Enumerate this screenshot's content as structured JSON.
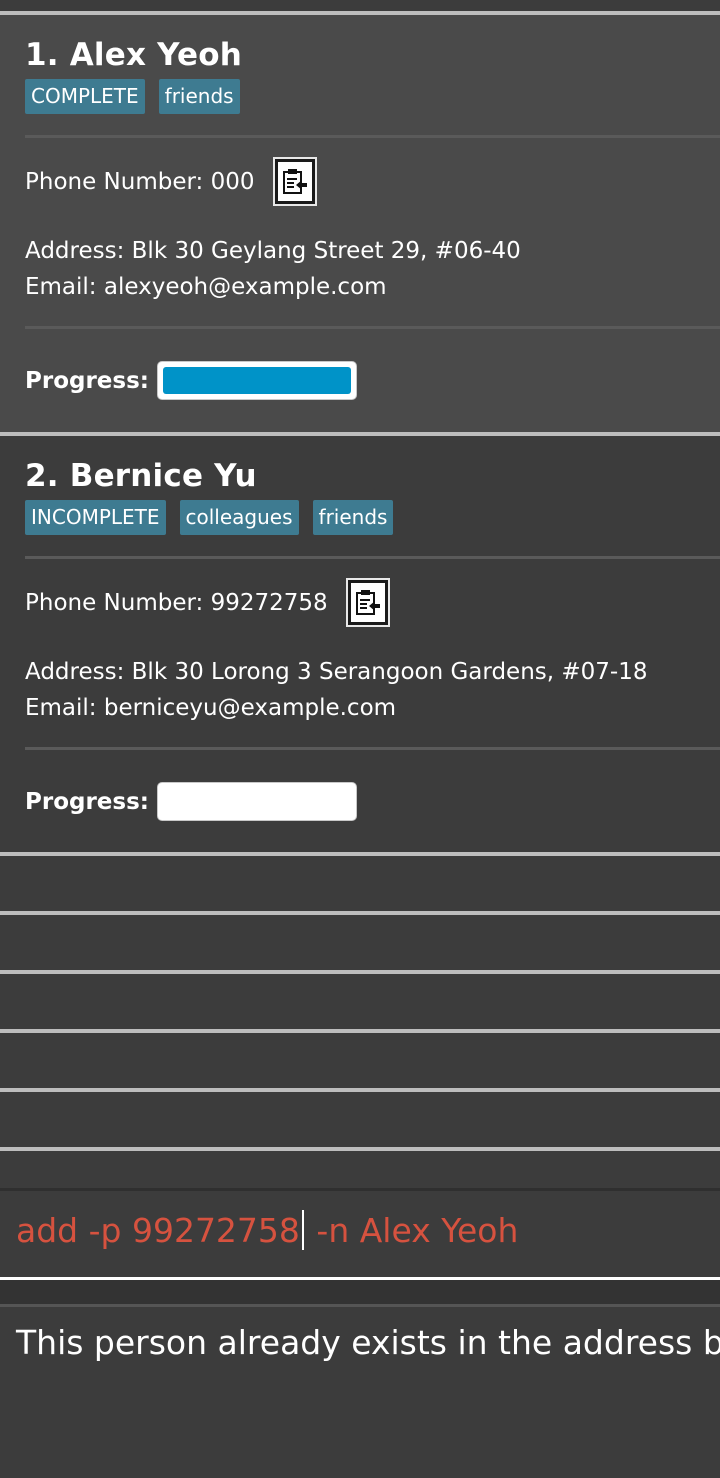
{
  "persons": [
    {
      "name": "1.  Alex Yeoh",
      "tags": [
        "COMPLETE",
        "friends"
      ],
      "phone": "Phone Number: 000",
      "address": "Address: Blk 30 Geylang Street 29, #06-40",
      "email": "Email: alexyeoh@example.com",
      "progress_label": "Progress:",
      "progress": 1.0
    },
    {
      "name": "2.  Bernice Yu",
      "tags": [
        "INCOMPLETE",
        "colleagues",
        "friends"
      ],
      "phone": "Phone Number: 99272758",
      "address": "Address: Blk 30 Lorong 3 Serangoon Gardens, #07-18",
      "email": "Email: berniceyu@example.com",
      "progress_label": "Progress:",
      "progress": 0.0
    }
  ],
  "command": {
    "before_caret": "add -p 99272758",
    "after_caret": " -n Alex Yeoh"
  },
  "result": {
    "text": "This person already exists in the address boo"
  },
  "colors": {
    "tag_bg": "#3e7b91",
    "progress_fill": "#0093c8",
    "command_error_text": "#d6523f"
  },
  "icons": {
    "copy_button": "copy-phone-icon"
  }
}
